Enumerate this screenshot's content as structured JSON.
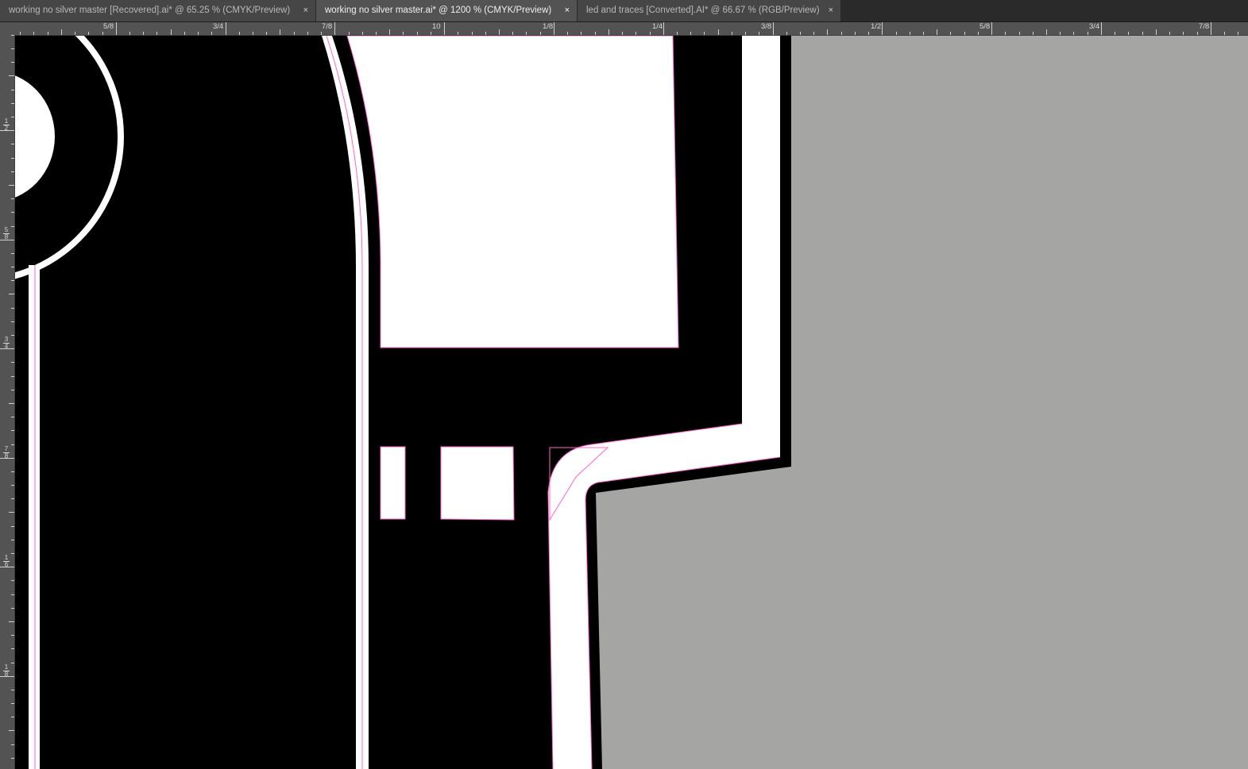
{
  "tabs": [
    {
      "title": "working no silver master [Recovered].ai* @ 65.25 % (CMYK/Preview)",
      "close": "×",
      "active": false
    },
    {
      "title": "working no silver master.ai* @ 1200 % (CMYK/Preview)",
      "close": "×",
      "active": true
    },
    {
      "title": "led and traces [Converted].AI* @ 66.67 % (RGB/Preview)",
      "close": "×",
      "active": false
    }
  ],
  "ruler_h_labels": [
    "5/8",
    "3/4",
    "7/8",
    "10",
    "1/8",
    "1/4",
    "3/8",
    "1/2",
    "5/8",
    "3/4",
    "7/8"
  ],
  "ruler_v_labels": [
    {
      "num": "1",
      "den": "2"
    },
    {
      "num": "5",
      "den": "8"
    },
    {
      "num": "3",
      "den": "4"
    },
    {
      "num": "7",
      "den": "8"
    },
    {
      "num": "1",
      "den": "6"
    },
    {
      "num": "1",
      "den": "8"
    }
  ],
  "colors": {
    "pasteboard": "#a5a5a3",
    "artwork_black": "#000000",
    "artwork_white": "#ffffff",
    "selection_outline": "#ff66cc",
    "ui_panel": "#535353"
  }
}
